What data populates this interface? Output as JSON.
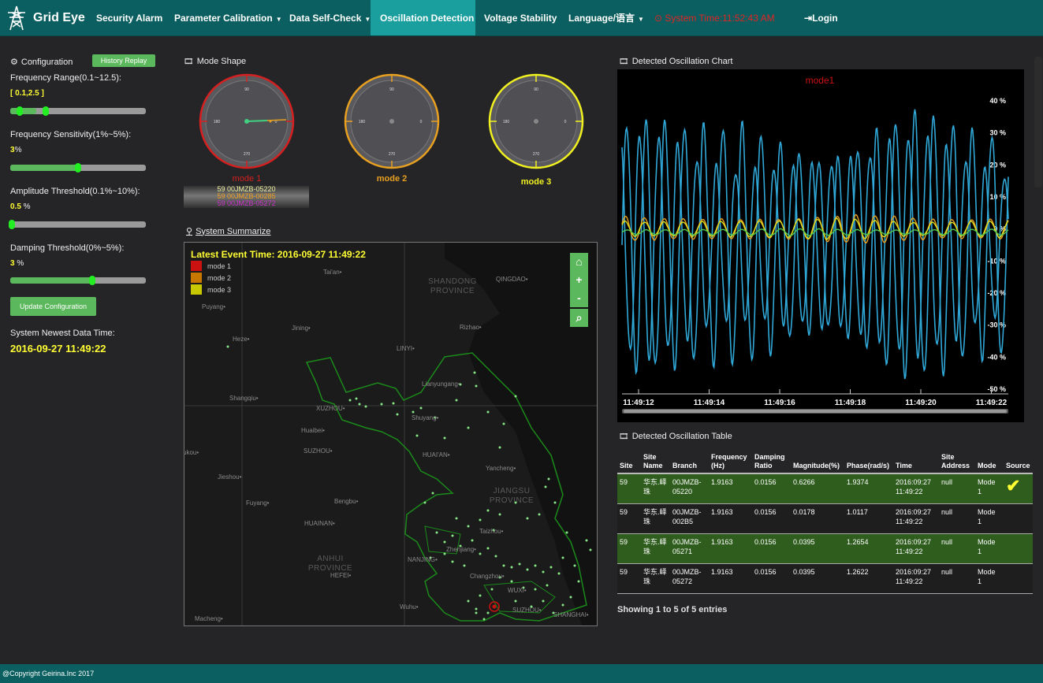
{
  "nav": {
    "brand": "Grid Eye",
    "items": [
      {
        "label": "Security Alarm",
        "caret": false
      },
      {
        "label": "Parameter Calibration",
        "caret": true
      },
      {
        "label": "Data Self-Check",
        "caret": true
      },
      {
        "label": "Oscillation Detection",
        "caret": false,
        "active": true
      },
      {
        "label": "Voltage Stability",
        "caret": false
      },
      {
        "label": "Language/语言",
        "caret": true
      }
    ],
    "system_time": "System Time:11:52:43 AM",
    "login": "Login"
  },
  "sidebar": {
    "title": "Configuration",
    "history_button": "History Replay",
    "frequency_range_label": "Frequency Range(0.1~12.5):",
    "frequency_range_value": "[ 0.1,2.5 ]",
    "frequency_sensitivity_label": "Frequency Sensitivity(1%~5%):",
    "frequency_sensitivity_value": "3",
    "amplitude_threshold_label": "Amplitude Threshold(0.1%~10%):",
    "amplitude_threshold_value": "0.5",
    "damping_threshold_label": "Damping Threshold(0%~5%):",
    "damping_threshold_value": "3",
    "percent": "%",
    "percent_spaced": " %",
    "update_button": "Update Configuration",
    "newest_label": "System Newest Data Time:",
    "newest_value": "2016-09-27 11:49:22",
    "sliders": {
      "range_low": 0.0,
      "range_high": 0.2,
      "sensitivity": 0.5,
      "amplitude": 0.0,
      "damping": 0.6
    }
  },
  "mode_shape": {
    "title": "Mode Shape",
    "gauges": [
      {
        "label": "mode 1",
        "color": "#d61f1f"
      },
      {
        "label": "mode 2",
        "color": "#e8a020"
      },
      {
        "label": "mode 3",
        "color": "#f0f020"
      }
    ],
    "ticks": {
      "top": "90",
      "left": "180",
      "right": "0",
      "bottom": "270"
    },
    "ticker": [
      {
        "text": "59 00JMZB-05220",
        "color": "#f0f0a0"
      },
      {
        "text": "59 00JMZB-00285",
        "color": "#f0a020"
      },
      {
        "text": "59 00JMZB-05272",
        "color": "#cc33cc"
      }
    ]
  },
  "map": {
    "title": "System Summarize",
    "event_time": "Latest Event Time: 2016-09-27 11:49:22",
    "legend": [
      {
        "label": "mode 1",
        "color": "#cc1111"
      },
      {
        "label": "mode 2",
        "color": "#c87800"
      },
      {
        "label": "mode 3",
        "color": "#c8c800"
      }
    ],
    "buttons": {
      "home": "⌂",
      "zoom_in": "+",
      "zoom_out": "-",
      "zoom_box": "⌕"
    },
    "cities": [
      {
        "name": "Tai'an•"
      },
      {
        "name": "Puyang•"
      },
      {
        "name": "Jining•"
      },
      {
        "name": "Rizhao•"
      },
      {
        "name": "Heze•"
      },
      {
        "name": "LINYI•"
      },
      {
        "name": "Lianyungang•"
      },
      {
        "name": "Shangqiu•"
      },
      {
        "name": "XUZHOU•"
      },
      {
        "name": "Shuyang•"
      },
      {
        "name": "Huaibei•"
      },
      {
        "name": "SUZHOU•"
      },
      {
        "name": "HUAI'AN•"
      },
      {
        "name": "ukou•"
      },
      {
        "name": "Jieshou•"
      },
      {
        "name": "Yancheng•"
      },
      {
        "name": "Fuyang•"
      },
      {
        "name": "Bengbu•"
      },
      {
        "name": "HUAINAN•"
      },
      {
        "name": "Taizhou•"
      },
      {
        "name": "NANJING•"
      },
      {
        "name": "Zhenjiang•"
      },
      {
        "name": "HEFEI•"
      },
      {
        "name": "Changzhou•"
      },
      {
        "name": "WUXI•"
      },
      {
        "name": "Wuhu•"
      },
      {
        "name": "SUZHOU•"
      },
      {
        "name": "SHANGHAI•"
      },
      {
        "name": "Macheng•"
      },
      {
        "name": "QINGDAO•"
      }
    ],
    "provinces": [
      {
        "name": "SHANDONG PROVINCE"
      },
      {
        "name": "JIANGSU PROVINCE"
      },
      {
        "name": "ANHUI PROVINCE"
      }
    ]
  },
  "chart": {
    "title": "Detected Oscillation Chart",
    "chart_data": {
      "type": "line",
      "title": "mode1",
      "x": [
        "11:49:12",
        "11:49:14",
        "11:49:16",
        "11:49:18",
        "11:49:20",
        "11:49:22"
      ],
      "yticks": [
        "40 %",
        "30 %",
        "20 %",
        "10 %",
        "0 %",
        "-10 %",
        "-20 %",
        "-30 %",
        "-40 %",
        "-50 %"
      ],
      "ylim": [
        -50,
        40
      ],
      "series": [
        {
          "color": "#30a8d8",
          "amplitude": 40,
          "frequency_hz": 1.9163
        },
        {
          "color": "#30a8d8",
          "amplitude": 32,
          "frequency_hz": 1.9163
        },
        {
          "color": "#e8a020",
          "amplitude": 4,
          "frequency_hz": 1.9163
        },
        {
          "color": "#e0e020",
          "amplitude": 3,
          "frequency_hz": 1.9163
        },
        {
          "color": "#50c850",
          "amplitude": 1,
          "frequency_hz": 1.9163
        }
      ]
    }
  },
  "table": {
    "title": "Detected Oscillation Table",
    "headers": [
      "Site",
      "Site Name",
      "Branch",
      "Frequency (Hz)",
      "Damping Ratio",
      "Magnitude(%)",
      "Phase(rad/s)",
      "Time",
      "Site Address",
      "Mode",
      "Source"
    ],
    "rows": [
      {
        "site": "59",
        "name": "华东.峄珠",
        "branch": "00JMZB-05220",
        "freq": "1.9163",
        "damping": "0.0156",
        "mag": "0.6266",
        "phase": "1.9374",
        "time": "2016:09:27 11:49:22",
        "addr": "null",
        "mode": "Mode 1",
        "source": "✔"
      },
      {
        "site": "59",
        "name": "华东.峄珠",
        "branch": "00JMZB-002B5",
        "freq": "1.9163",
        "damping": "0.0156",
        "mag": "0.0178",
        "phase": "1.0117",
        "time": "2016:09:27 11:49:22",
        "addr": "null",
        "mode": "Mode 1",
        "source": ""
      },
      {
        "site": "59",
        "name": "华东.峄珠",
        "branch": "00JMZB-05271",
        "freq": "1.9163",
        "damping": "0.0156",
        "mag": "0.0395",
        "phase": "1.2654",
        "time": "2016:09:27 11:49:22",
        "addr": "null",
        "mode": "Mode 1",
        "source": ""
      },
      {
        "site": "59",
        "name": "华东.峄珠",
        "branch": "00JMZB-05272",
        "freq": "1.9163",
        "damping": "0.0156",
        "mag": "0.0395",
        "phase": "1.2622",
        "time": "2016:09:27 11:49:22",
        "addr": "null",
        "mode": "Mode 1",
        "source": ""
      }
    ],
    "info": "Showing 1 to 5 of 5 entries"
  },
  "footer": "@Copyright Geirina.Inc 2017"
}
